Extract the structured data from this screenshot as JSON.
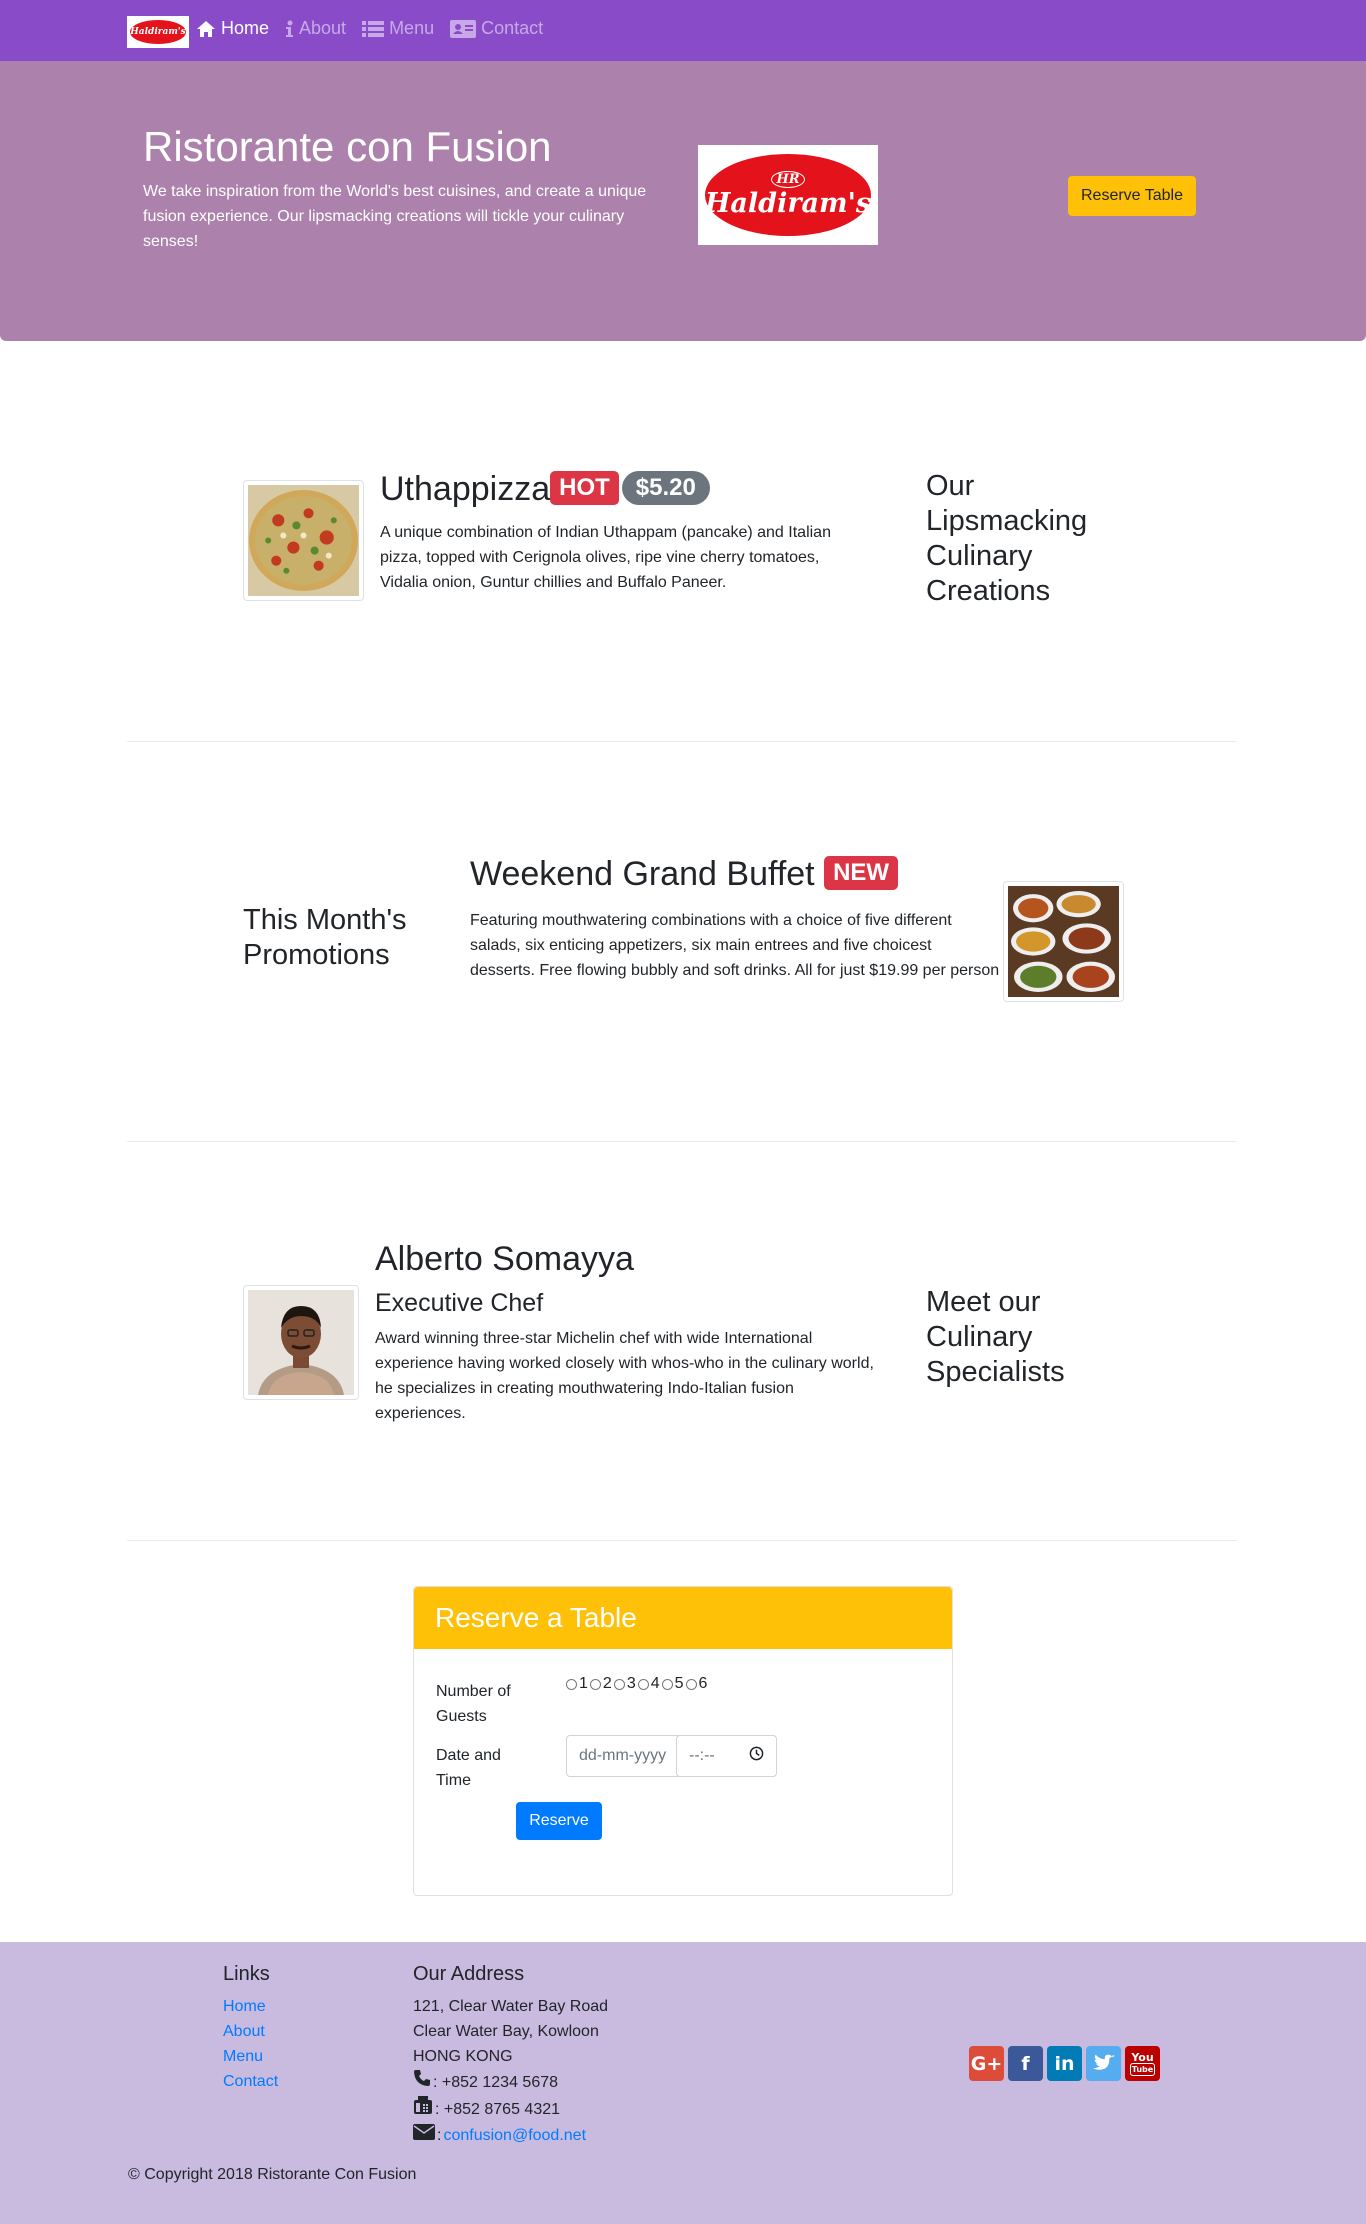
{
  "navbar": {
    "brand_logo": "Haldiram's",
    "items": [
      {
        "label": "Home",
        "icon": "home-icon",
        "active": true
      },
      {
        "label": "About",
        "icon": "info-icon",
        "active": false
      },
      {
        "label": "Menu",
        "icon": "list-icon",
        "active": false
      },
      {
        "label": "Contact",
        "icon": "address-card-icon",
        "active": false
      }
    ],
    "colors": {
      "background": "#8a4bc9",
      "inactive_text": "#c7a9e8",
      "active_text": "#ffffff"
    }
  },
  "jumbotron": {
    "title": "Ristorante con Fusion",
    "text": "We take inspiration from the World's best cuisines, and create a unique fusion experience. Our lipsmacking creations will tickle your culinary senses!",
    "logo_text": "Haldiram's",
    "logo_monogram": "HR",
    "reserve_button": "Reserve Table",
    "background": "#ac82ac"
  },
  "dish": {
    "name": "Uthappizza",
    "badge": "HOT",
    "price": "$5.20",
    "description": "A unique combination of Indian Uthappam (pancake) and Italian pizza, topped with Cerignola olives, ripe vine cherry tomatoes, Vidalia onion, Guntur chillies and Buffalo Paneer.",
    "section_title": "Our Lipsmacking Culinary Creations"
  },
  "promotion": {
    "name": "Weekend Grand Buffet",
    "badge": "NEW",
    "description": "Featuring mouthwatering combinations with a choice of five different salads, six enticing appetizers, six main entrees and five choicest desserts. Free flowing bubbly and soft drinks. All for just $19.99 per person",
    "section_title": "This Month's Promotions"
  },
  "leader": {
    "name": "Alberto Somayya",
    "designation": "Executive Chef",
    "description": "Award winning three-star Michelin chef with wide International experience having worked closely with whos-who in the culinary world, he specializes in creating mouthwatering Indo-Italian fusion experiences.",
    "section_title": "Meet our Culinary Specialists"
  },
  "reservation": {
    "header": "Reserve a Table",
    "guests_label": "Number of Guests",
    "guest_options": [
      "1",
      "2",
      "3",
      "4",
      "5",
      "6"
    ],
    "datetime_label": "Date and Time",
    "date_placeholder": "dd-mm-yyyy",
    "time_placeholder": "--:--",
    "submit": "Reserve",
    "header_color": "#ffc107"
  },
  "footer": {
    "links_title": "Links",
    "links": [
      "Home",
      "About",
      "Menu",
      "Contact"
    ],
    "address_title": "Our Address",
    "address_lines": [
      "121, Clear Water Bay Road",
      "Clear Water Bay, Kowloon",
      "HONG KONG"
    ],
    "phone": ": +852 1234 5678",
    "fax": ": +852 8765 4321",
    "email_prefix": ": ",
    "email": "confusion@food.net",
    "socials": [
      {
        "icon": "google-plus-icon",
        "label": "G+",
        "color": "#dd4b39"
      },
      {
        "icon": "facebook-icon",
        "label": "f",
        "color": "#3b5998"
      },
      {
        "icon": "linkedin-icon",
        "label": "in",
        "color": "#007bb6"
      },
      {
        "icon": "twitter-icon",
        "label": "🐦",
        "color": "#55acee"
      },
      {
        "icon": "youtube-icon",
        "label": "You",
        "color": "#bb0000"
      }
    ],
    "copyright": "© Copyright 2018 Ristorante Con Fusion",
    "background": "#c9bbe0"
  }
}
